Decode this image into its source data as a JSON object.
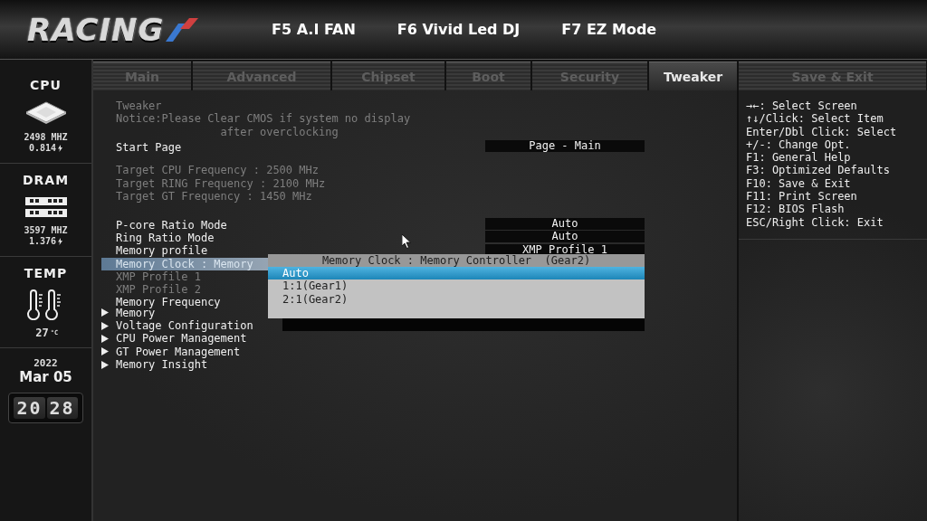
{
  "header": {
    "logo": "RACING",
    "hotkeys": [
      "F5 A.I FAN",
      "F6 Vivid Led DJ",
      "F7 EZ Mode"
    ]
  },
  "sidebar": {
    "cpu": {
      "title": "CPU",
      "frequency": "2498 MHZ",
      "voltage": "0.814"
    },
    "dram": {
      "title": "DRAM",
      "frequency": "3597 MHZ",
      "voltage": "1.376"
    },
    "temp": {
      "title": "TEMP",
      "value": "27",
      "unit": "°C"
    },
    "date": {
      "year": "2022",
      "day": "Mar 05"
    },
    "clock": [
      "20",
      "28"
    ]
  },
  "tabs": [
    {
      "label": "Main",
      "selected": false
    },
    {
      "label": "Advanced",
      "selected": false
    },
    {
      "label": "Chipset",
      "selected": false
    },
    {
      "label": "Boot",
      "selected": false
    },
    {
      "label": "Security",
      "selected": false
    },
    {
      "label": "Tweaker",
      "selected": true
    },
    {
      "label": "Save & Exit",
      "selected": false
    }
  ],
  "groups": [
    [
      {
        "kind": "text",
        "label": "Tweaker",
        "disabled": true
      },
      {
        "kind": "notice",
        "label": "Notice:Please Clear CMOS if system no display",
        "label_2": "after overclocking",
        "disabled": true
      },
      {
        "kind": "setting",
        "label": "Start Page",
        "value": "Page - Main",
        "disabled": false,
        "selected": false
      }
    ],
    [
      {
        "kind": "text",
        "label": "Target CPU Frequency : 2500 MHz",
        "disabled": true
      },
      {
        "kind": "text",
        "label": "Target RING Frequency : 2100 MHz",
        "disabled": true
      },
      {
        "kind": "text",
        "label": "Target GT Frequency : 1450 MHz",
        "disabled": true
      }
    ],
    [
      {
        "kind": "setting",
        "label": "P-core Ratio Mode",
        "value": "Auto",
        "disabled": false,
        "selected": false
      },
      {
        "kind": "setting",
        "label": "Ring Ratio Mode",
        "value": "Auto",
        "disabled": false,
        "selected": false
      },
      {
        "kind": "setting",
        "label": "Memory profile",
        "value": "XMP Profile 1",
        "disabled": false,
        "selected": false
      },
      {
        "kind": "setting",
        "label": "Memory Clock : Memory",
        "disabled": false,
        "selected": true
      },
      {
        "kind": "setting",
        "label": "XMP Profile 1",
        "disabled": true,
        "selected": false
      },
      {
        "kind": "setting",
        "label": "XMP Profile 2",
        "disabled": true,
        "selected": false
      },
      {
        "kind": "setting",
        "label": "Memory Frequency",
        "disabled": false,
        "selected": false
      },
      {
        "kind": "submenu",
        "label": "Memory"
      },
      {
        "kind": "submenu",
        "label": "Voltage Configuration"
      },
      {
        "kind": "submenu",
        "label": "CPU Power Management"
      },
      {
        "kind": "submenu",
        "label": "GT Power Management"
      },
      {
        "kind": "submenu",
        "label": "Memory Insight"
      }
    ]
  ],
  "popup": {
    "title": "Memory Clock : Memory Controller  (Gear2)",
    "options": [
      {
        "label": "Auto",
        "selected": true
      },
      {
        "label": "1:1(Gear1)",
        "selected": false
      },
      {
        "label": "2:1(Gear2)",
        "selected": false
      }
    ]
  },
  "help": [
    "→←: Select Screen",
    "↑↓/Click: Select Item",
    "Enter/Dbl Click: Select",
    "+/-: Change Opt.",
    "F1: General Help",
    "F3: Optimized Defaults",
    "F10: Save & Exit",
    "F11: Print Screen",
    "F12: BIOS Flash",
    "ESC/Right Click: Exit"
  ]
}
